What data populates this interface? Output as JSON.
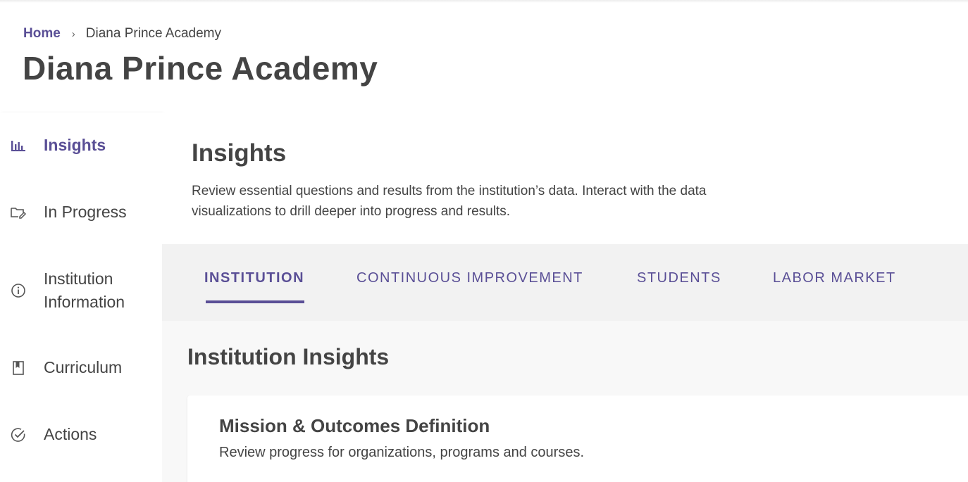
{
  "breadcrumb": {
    "home": "Home",
    "separator": "›",
    "current": "Diana Prince Academy"
  },
  "page": {
    "title": "Diana Prince Academy"
  },
  "sidebar": {
    "items": [
      {
        "label": "Insights",
        "icon": "bar-chart-icon",
        "active": true
      },
      {
        "label": "In Progress",
        "icon": "folder-edit-icon",
        "active": false
      },
      {
        "label": "Institution\nInformation",
        "icon": "info-icon",
        "active": false
      },
      {
        "label": "Curriculum",
        "icon": "bookmark-book-icon",
        "active": false
      },
      {
        "label": "Actions",
        "icon": "check-circle-icon",
        "active": false
      }
    ]
  },
  "intro": {
    "title": "Insights",
    "description": "Review essential questions and results from the institution’s data. Interact with the data visualizations to drill deeper into progress and results."
  },
  "tabs": [
    {
      "label": "INSTITUTION",
      "active": true
    },
    {
      "label": "CONTINUOUS IMPROVEMENT",
      "active": false
    },
    {
      "label": "STUDENTS",
      "active": false
    },
    {
      "label": "LABOR MARKET",
      "active": false
    }
  ],
  "section": {
    "title": "Institution Insights"
  },
  "card": {
    "title": "Mission & Outcomes Definition",
    "description": "Review progress for organizations, programs and courses."
  },
  "colors": {
    "accent": "#5a4f96",
    "text": "#444444",
    "tab_bg": "#f2f2f2",
    "content_bg": "#f8f8f8"
  }
}
